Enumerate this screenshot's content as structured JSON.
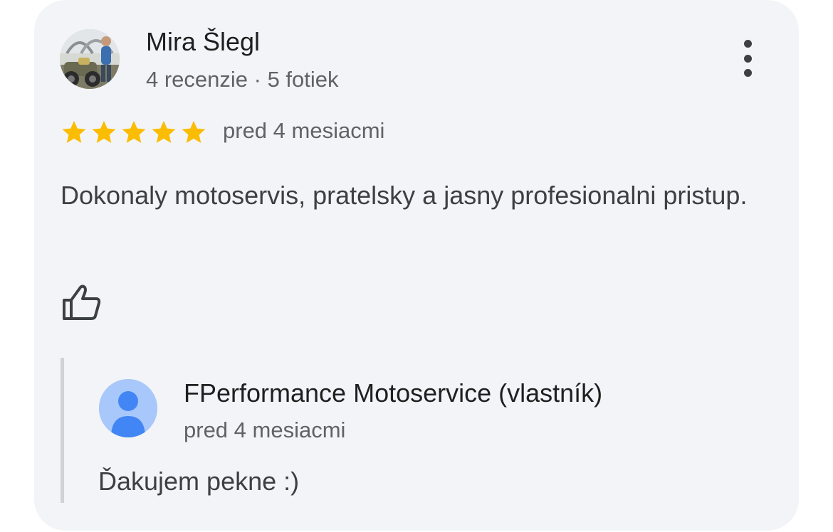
{
  "review": {
    "author": {
      "name": "Mira Šlegl",
      "meta": "4 recenzie · 5 fotiek",
      "avatar_icon": "user-photo-avatar"
    },
    "rating": 5,
    "rating_max": 5,
    "star_color": "#fbbc04",
    "time": "pred 4 mesiacmi",
    "text": "Dokonaly motoservis, pratelsky a jasny profesionalni pristup.",
    "icons": {
      "more": "more-vert-icon",
      "like": "thumb-up-icon"
    }
  },
  "reply": {
    "owner_name": "FPerformance Motoservice (vlastník)",
    "time": "pred 4 mesiacmi",
    "text": "Ďakujem pekne :)",
    "avatar_icon": "default-person-avatar",
    "avatar_colors": {
      "background": "#a8c7fa",
      "figure": "#4285f4"
    }
  },
  "colors": {
    "card_background": "#f2f4f8",
    "primary_text": "#1f1f1f",
    "secondary_text": "#5f6368"
  }
}
